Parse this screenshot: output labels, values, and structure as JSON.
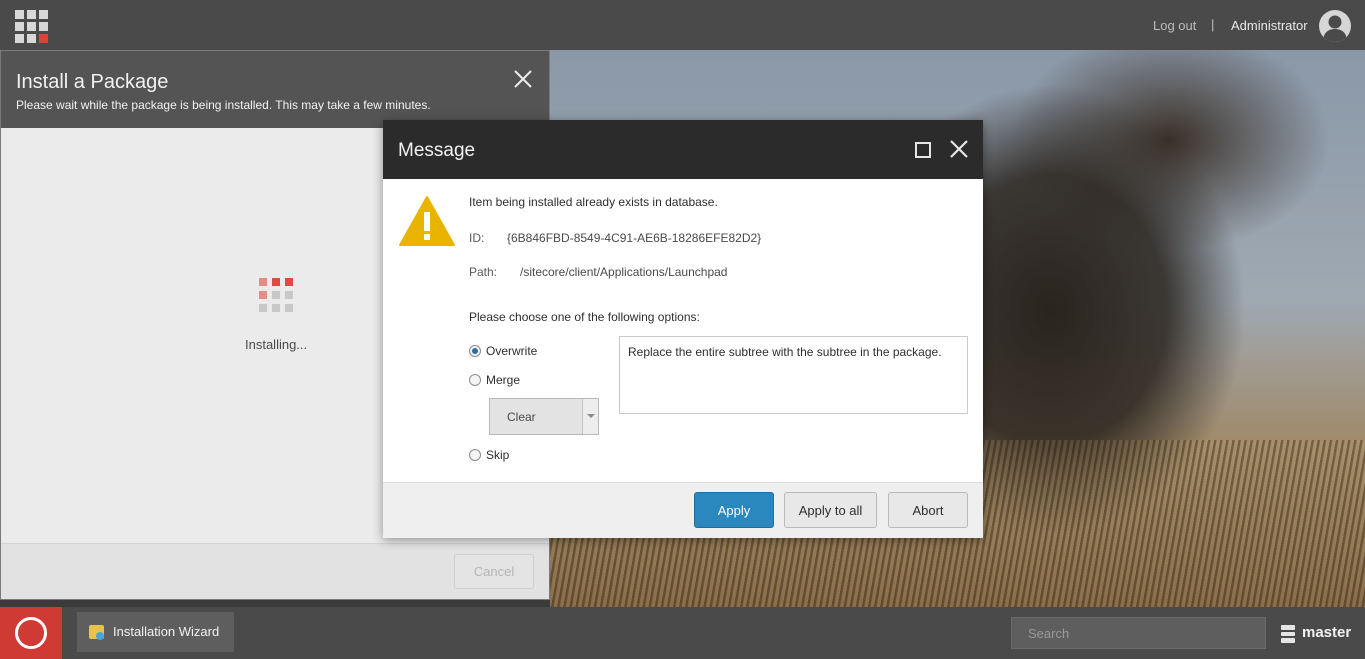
{
  "topbar": {
    "logout_label": "Log out",
    "separator": "|",
    "username": "Administrator"
  },
  "install_dialog": {
    "title": "Install a Package",
    "subtitle": "Please wait while the package is being installed. This may take a few minutes.",
    "status": "Installing...",
    "cancel_label": "Cancel"
  },
  "message": {
    "title": "Message",
    "headline": "Item being installed already exists in database.",
    "id_label": "ID:",
    "id_value": "{6B846FBD-8549-4C91-AE6B-18286EFE82D2}",
    "path_label": "Path:",
    "path_value": "/sitecore/client/Applications/Launchpad",
    "prompt": "Please choose one of the following options:",
    "options": [
      {
        "label": "Overwrite",
        "checked": true
      },
      {
        "label": "Merge",
        "checked": false
      },
      {
        "label": "Skip",
        "checked": false
      }
    ],
    "merge_mode_selected": "Clear",
    "description": "Replace the entire subtree with the subtree in the package.",
    "buttons": {
      "apply": "Apply",
      "apply_all": "Apply to all",
      "abort": "Abort"
    }
  },
  "taskbar": {
    "task_label": "Installation Wizard",
    "search_placeholder": "Search",
    "database": "master"
  },
  "colors": {
    "accent_red": "#cf3a35",
    "primary_blue": "#2b88be",
    "warning_yellow": "#e8b400"
  }
}
